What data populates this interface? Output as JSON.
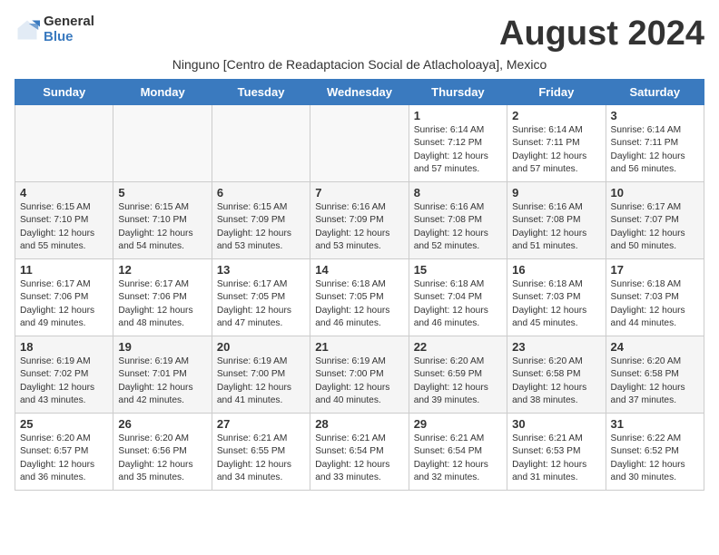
{
  "logo": {
    "general": "General",
    "blue": "Blue"
  },
  "title": "August 2024",
  "subtitle": "Ninguno [Centro de Readaptacion Social de Atlacholoaya], Mexico",
  "days_of_week": [
    "Sunday",
    "Monday",
    "Tuesday",
    "Wednesday",
    "Thursday",
    "Friday",
    "Saturday"
  ],
  "weeks": [
    {
      "shade": "odd",
      "days": [
        {
          "num": "",
          "empty": true
        },
        {
          "num": "",
          "empty": true
        },
        {
          "num": "",
          "empty": true
        },
        {
          "num": "",
          "empty": true
        },
        {
          "num": "1",
          "sunrise": "6:14 AM",
          "sunset": "7:12 PM",
          "daylight": "12 hours and 57 minutes."
        },
        {
          "num": "2",
          "sunrise": "6:14 AM",
          "sunset": "7:11 PM",
          "daylight": "12 hours and 57 minutes."
        },
        {
          "num": "3",
          "sunrise": "6:14 AM",
          "sunset": "7:11 PM",
          "daylight": "12 hours and 56 minutes."
        }
      ]
    },
    {
      "shade": "even",
      "days": [
        {
          "num": "4",
          "sunrise": "6:15 AM",
          "sunset": "7:10 PM",
          "daylight": "12 hours and 55 minutes."
        },
        {
          "num": "5",
          "sunrise": "6:15 AM",
          "sunset": "7:10 PM",
          "daylight": "12 hours and 54 minutes."
        },
        {
          "num": "6",
          "sunrise": "6:15 AM",
          "sunset": "7:09 PM",
          "daylight": "12 hours and 53 minutes."
        },
        {
          "num": "7",
          "sunrise": "6:16 AM",
          "sunset": "7:09 PM",
          "daylight": "12 hours and 53 minutes."
        },
        {
          "num": "8",
          "sunrise": "6:16 AM",
          "sunset": "7:08 PM",
          "daylight": "12 hours and 52 minutes."
        },
        {
          "num": "9",
          "sunrise": "6:16 AM",
          "sunset": "7:08 PM",
          "daylight": "12 hours and 51 minutes."
        },
        {
          "num": "10",
          "sunrise": "6:17 AM",
          "sunset": "7:07 PM",
          "daylight": "12 hours and 50 minutes."
        }
      ]
    },
    {
      "shade": "odd",
      "days": [
        {
          "num": "11",
          "sunrise": "6:17 AM",
          "sunset": "7:06 PM",
          "daylight": "12 hours and 49 minutes."
        },
        {
          "num": "12",
          "sunrise": "6:17 AM",
          "sunset": "7:06 PM",
          "daylight": "12 hours and 48 minutes."
        },
        {
          "num": "13",
          "sunrise": "6:17 AM",
          "sunset": "7:05 PM",
          "daylight": "12 hours and 47 minutes."
        },
        {
          "num": "14",
          "sunrise": "6:18 AM",
          "sunset": "7:05 PM",
          "daylight": "12 hours and 46 minutes."
        },
        {
          "num": "15",
          "sunrise": "6:18 AM",
          "sunset": "7:04 PM",
          "daylight": "12 hours and 46 minutes."
        },
        {
          "num": "16",
          "sunrise": "6:18 AM",
          "sunset": "7:03 PM",
          "daylight": "12 hours and 45 minutes."
        },
        {
          "num": "17",
          "sunrise": "6:18 AM",
          "sunset": "7:03 PM",
          "daylight": "12 hours and 44 minutes."
        }
      ]
    },
    {
      "shade": "even",
      "days": [
        {
          "num": "18",
          "sunrise": "6:19 AM",
          "sunset": "7:02 PM",
          "daylight": "12 hours and 43 minutes."
        },
        {
          "num": "19",
          "sunrise": "6:19 AM",
          "sunset": "7:01 PM",
          "daylight": "12 hours and 42 minutes."
        },
        {
          "num": "20",
          "sunrise": "6:19 AM",
          "sunset": "7:00 PM",
          "daylight": "12 hours and 41 minutes."
        },
        {
          "num": "21",
          "sunrise": "6:19 AM",
          "sunset": "7:00 PM",
          "daylight": "12 hours and 40 minutes."
        },
        {
          "num": "22",
          "sunrise": "6:20 AM",
          "sunset": "6:59 PM",
          "daylight": "12 hours and 39 minutes."
        },
        {
          "num": "23",
          "sunrise": "6:20 AM",
          "sunset": "6:58 PM",
          "daylight": "12 hours and 38 minutes."
        },
        {
          "num": "24",
          "sunrise": "6:20 AM",
          "sunset": "6:58 PM",
          "daylight": "12 hours and 37 minutes."
        }
      ]
    },
    {
      "shade": "odd",
      "days": [
        {
          "num": "25",
          "sunrise": "6:20 AM",
          "sunset": "6:57 PM",
          "daylight": "12 hours and 36 minutes."
        },
        {
          "num": "26",
          "sunrise": "6:20 AM",
          "sunset": "6:56 PM",
          "daylight": "12 hours and 35 minutes."
        },
        {
          "num": "27",
          "sunrise": "6:21 AM",
          "sunset": "6:55 PM",
          "daylight": "12 hours and 34 minutes."
        },
        {
          "num": "28",
          "sunrise": "6:21 AM",
          "sunset": "6:54 PM",
          "daylight": "12 hours and 33 minutes."
        },
        {
          "num": "29",
          "sunrise": "6:21 AM",
          "sunset": "6:54 PM",
          "daylight": "12 hours and 32 minutes."
        },
        {
          "num": "30",
          "sunrise": "6:21 AM",
          "sunset": "6:53 PM",
          "daylight": "12 hours and 31 minutes."
        },
        {
          "num": "31",
          "sunrise": "6:22 AM",
          "sunset": "6:52 PM",
          "daylight": "12 hours and 30 minutes."
        }
      ]
    }
  ]
}
